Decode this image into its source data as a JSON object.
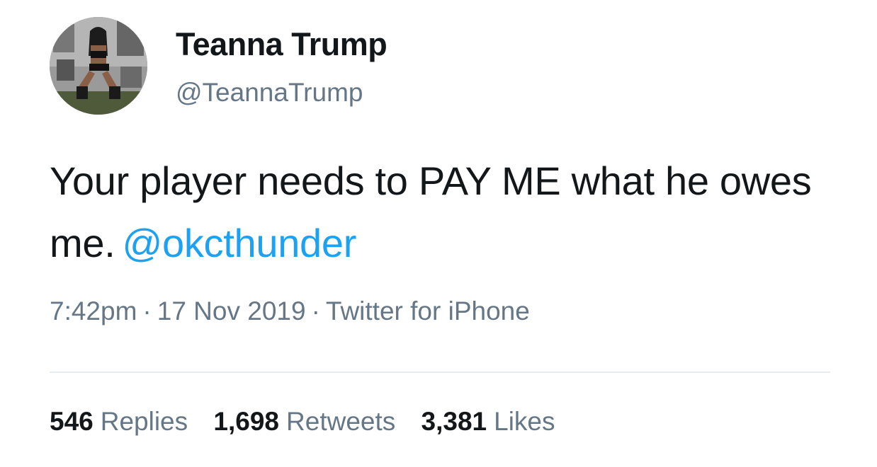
{
  "user": {
    "name": "Teanna Trump",
    "handle": "@TeannaTrump"
  },
  "tweet": {
    "text": "Your player needs to PAY ME what he owes me.",
    "mention": "@okcthunder",
    "time": "7:42pm",
    "date": "17 Nov 2019",
    "source": "Twitter for iPhone",
    "separator": "·"
  },
  "stats": [
    {
      "count": "546",
      "label": "Replies"
    },
    {
      "count": "1,698",
      "label": "Retweets"
    },
    {
      "count": "3,381",
      "label": "Likes"
    }
  ],
  "colors": {
    "text": "#14171a",
    "secondary": "#657786",
    "link": "#1da1f2",
    "divider": "#e6ecf0"
  }
}
